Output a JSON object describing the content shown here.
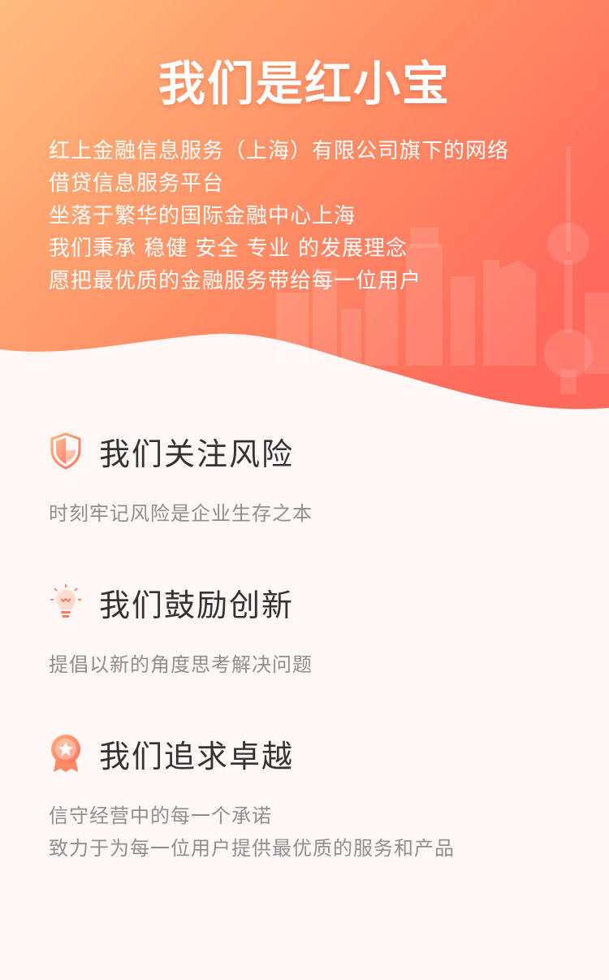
{
  "hero": {
    "title": "我们是红小宝",
    "lines": [
      "红上金融信息服务（上海）有限公司旗下的网络",
      "借贷信息服务平台",
      "坐落于繁华的国际金融中心上海",
      "我们秉承 稳健 安全 专业 的发展理念",
      "愿把最优质的金融服务带给每一位用户"
    ],
    "gradient_start": "#ffb27a",
    "gradient_end": "#ff6a5c"
  },
  "features": [
    {
      "icon": "shield-icon",
      "title": "我们关注风险",
      "lines": [
        "时刻牢记风险是企业生存之本"
      ]
    },
    {
      "icon": "lightbulb-icon",
      "title": "我们鼓励创新",
      "lines": [
        "提倡以新的角度思考解决问题"
      ]
    },
    {
      "icon": "medal-icon",
      "title": "我们追求卓越",
      "lines": [
        "信守经营中的每一个承诺",
        "致力于为每一位用户提供最优质的服务和产品"
      ]
    }
  ],
  "colors": {
    "accent": "#ff7a5c",
    "title_text": "#333333",
    "desc_text": "#8f8f8f",
    "background": "#fff7f5"
  }
}
